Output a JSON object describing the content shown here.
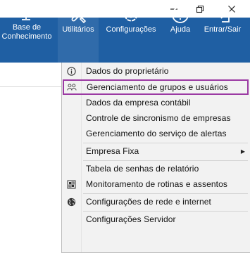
{
  "colors": {
    "toolbar_bg": "#1f5fa3",
    "highlight_border": "#9b3aa3",
    "menu_bg": "#f2f2f2"
  },
  "window_controls": {
    "minimize_icon": "minimize-icon",
    "restore_icon": "restore-icon",
    "close_icon": "close-icon"
  },
  "toolbar": {
    "base": {
      "label": "Base de Conhecimento",
      "line1": "Base de",
      "line2": "Conhecimento",
      "icon": "monitor-icon"
    },
    "utilitarios": {
      "label": "Utilitários",
      "icon": "tools-icon"
    },
    "configuracoes": {
      "label": "Configurações",
      "icon": "gear-icon"
    },
    "ajuda": {
      "label": "Ajuda",
      "icon": "help-icon"
    },
    "entrar_sair": {
      "label": "Entrar/Sair",
      "icon": "login-icon"
    }
  },
  "menu": {
    "items": [
      {
        "label": "Dados do proprietário",
        "icon": "info-icon"
      },
      {
        "label": "Gerenciamento de grupos e usuários",
        "icon": "users-icon",
        "highlighted": true
      },
      {
        "label": "Dados da empresa contábil",
        "icon": ""
      },
      {
        "label": "Controle de sincronismo de empresas",
        "icon": ""
      },
      {
        "label": "Gerenciamento do serviço de alertas",
        "icon": ""
      },
      {
        "label": "Empresa Fixa",
        "icon": "",
        "submenu": true
      },
      {
        "label": "Tabela de senhas de relatório",
        "icon": ""
      },
      {
        "label": "Monitoramento de rotinas e assentos",
        "icon": "monitor-grid-icon"
      },
      {
        "label": "Configurações de rede e internet",
        "icon": "globe-icon"
      },
      {
        "label": "Configurações Servidor",
        "icon": ""
      }
    ]
  }
}
